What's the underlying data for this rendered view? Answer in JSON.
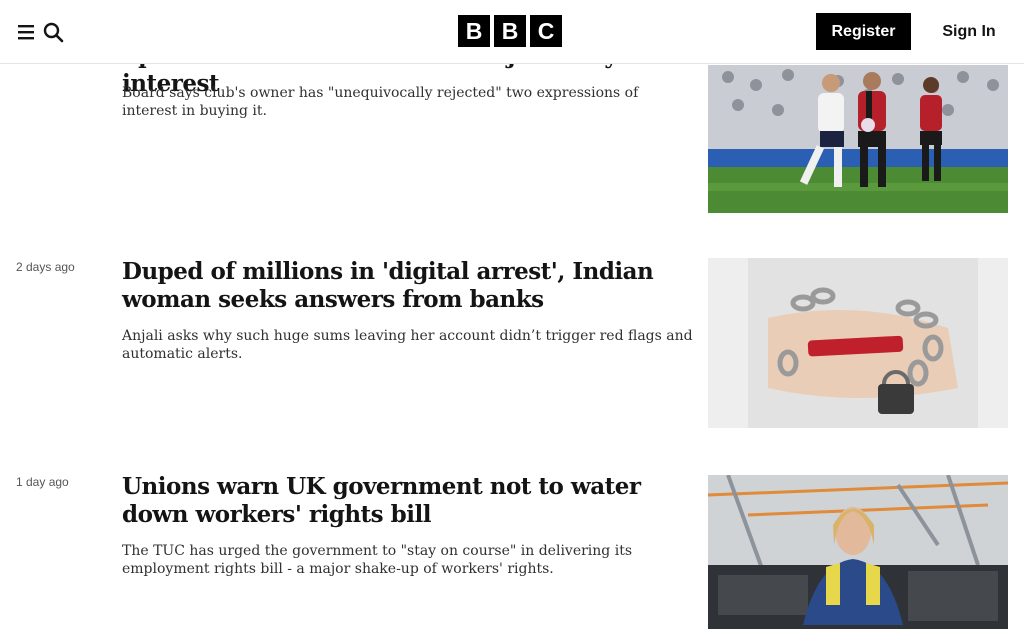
{
  "header": {
    "logo_letters": [
      "B",
      "B",
      "C"
    ],
    "register_label": "Register",
    "signin_label": "Sign In",
    "menu_icon": "menu-icon",
    "search_icon": "search-icon"
  },
  "stories": [
    {
      "time": "",
      "headline": "Spurs 'not for sale' as owner rejects buyout interest",
      "summary": "Board says club's owner has \"unequivocally rejected\" two expressions of interest in buying it.",
      "image": "football-match-photo"
    },
    {
      "time": "2 days ago",
      "headline": "Duped of millions in 'digital arrest', Indian woman seeks answers from banks",
      "summary": "Anjali asks why such huge sums leaving her account didn’t trigger red flags and automatic alerts.",
      "image": "chained-phone-photo"
    },
    {
      "time": "1 day ago",
      "headline": "Unions warn UK government not to water down workers' rights bill",
      "summary": "The TUC has urged the government to \"stay on course\" in delivering its employment rights bill - a major shake-up of workers' rights.",
      "image": "factory-worker-photo"
    }
  ]
}
